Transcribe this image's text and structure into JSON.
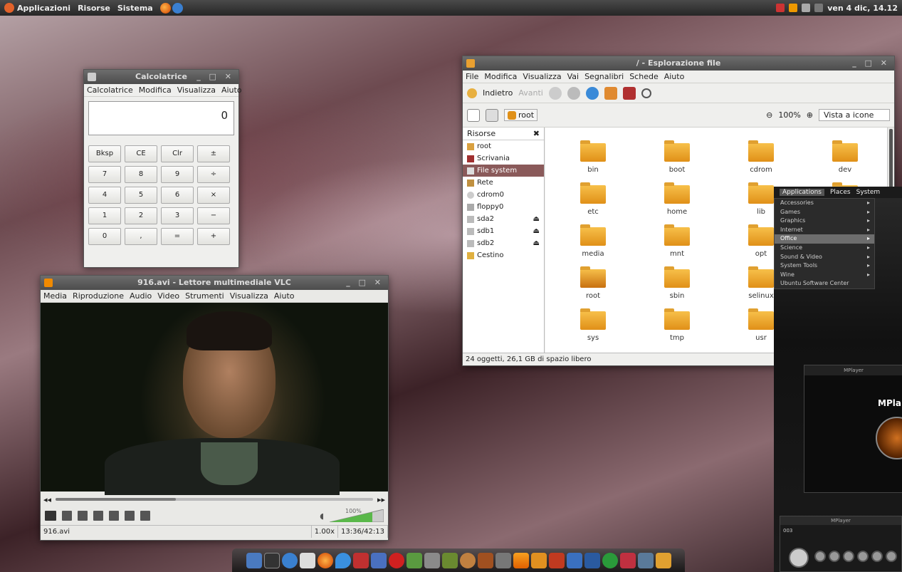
{
  "topbar": {
    "menus": [
      "Applicazioni",
      "Risorse",
      "Sistema"
    ],
    "clock": "ven 4 dic, 14.12"
  },
  "calculator": {
    "title": "Calcolatrice",
    "menu": [
      "Calcolatrice",
      "Modifica",
      "Visualizza",
      "Aiuto"
    ],
    "display": "0",
    "keys": [
      "Bksp",
      "CE",
      "Clr",
      "±",
      "7",
      "8",
      "9",
      "÷",
      "4",
      "5",
      "6",
      "×",
      "1",
      "2",
      "3",
      "−",
      "0",
      ",",
      "=",
      "+"
    ]
  },
  "files": {
    "title": "/ - Esplorazione file",
    "menu": [
      "File",
      "Modifica",
      "Visualizza",
      "Vai",
      "Segnalibri",
      "Schede",
      "Aiuto"
    ],
    "back": "Indietro",
    "forward": "Avanti",
    "location": "root",
    "zoom": "100%",
    "view": "Vista a icone",
    "sidebar_header": "Risorse",
    "sidebar": [
      "root",
      "Scrivania",
      "File system",
      "Rete",
      "cdrom0",
      "floppy0",
      "sda2",
      "sdb1",
      "sdb2",
      "Cestino"
    ],
    "folders": [
      "bin",
      "boot",
      "cdrom",
      "dev",
      "etc",
      "home",
      "lib",
      "",
      "media",
      "mnt",
      "opt",
      "",
      "root",
      "sbin",
      "selinux",
      "",
      "sys",
      "tmp",
      "usr",
      ""
    ],
    "status": "24 oggetti, 26,1 GB di spazio libero"
  },
  "vlc": {
    "title": "916.avi - Lettore multimediale VLC",
    "menu": [
      "Media",
      "Riproduzione",
      "Audio",
      "Video",
      "Strumenti",
      "Visualizza",
      "Aiuto"
    ],
    "progress": 0.38,
    "volume": "100%",
    "file": "916.avi",
    "speed": "1.00x",
    "time": "13:36/42:13"
  },
  "appmenu": {
    "bar": [
      "Applications",
      "Places",
      "System"
    ],
    "items": [
      "Accessories",
      "Games",
      "Graphics",
      "Internet",
      "Office",
      "Science",
      "Sound & Video",
      "System Tools",
      "Wine",
      "Ubuntu Software Center"
    ]
  },
  "mplayer": {
    "title": "MPlayer",
    "name": "MPla",
    "title2": "MPlayer",
    "track": "003"
  }
}
